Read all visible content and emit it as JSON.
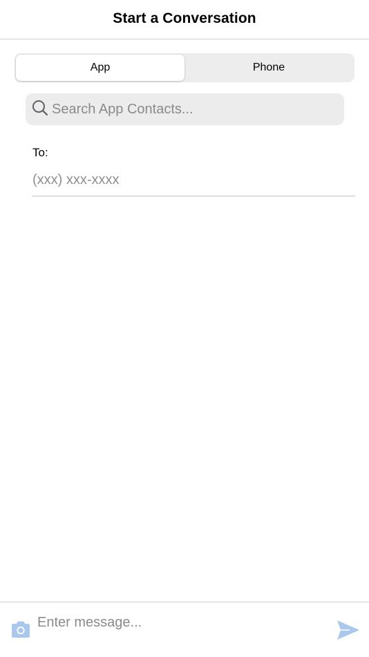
{
  "header": {
    "title": "Start a Conversation"
  },
  "segmented_control": {
    "segments": [
      {
        "label": "App",
        "selected": true
      },
      {
        "label": "Phone",
        "selected": false
      }
    ]
  },
  "search": {
    "placeholder": "Search App Contacts...",
    "value": "",
    "icon": "search-icon"
  },
  "recipient": {
    "label": "To:",
    "placeholder": "(xxx) xxx-xxxx",
    "value": ""
  },
  "composer": {
    "placeholder": "Enter message...",
    "value": "",
    "camera_icon": "camera-icon",
    "send_icon": "send-icon"
  },
  "colors": {
    "accent_light": "#a9c8ec",
    "segment_bg": "#ededee",
    "search_bg": "#ececed",
    "divider": "#cfcfd1"
  }
}
